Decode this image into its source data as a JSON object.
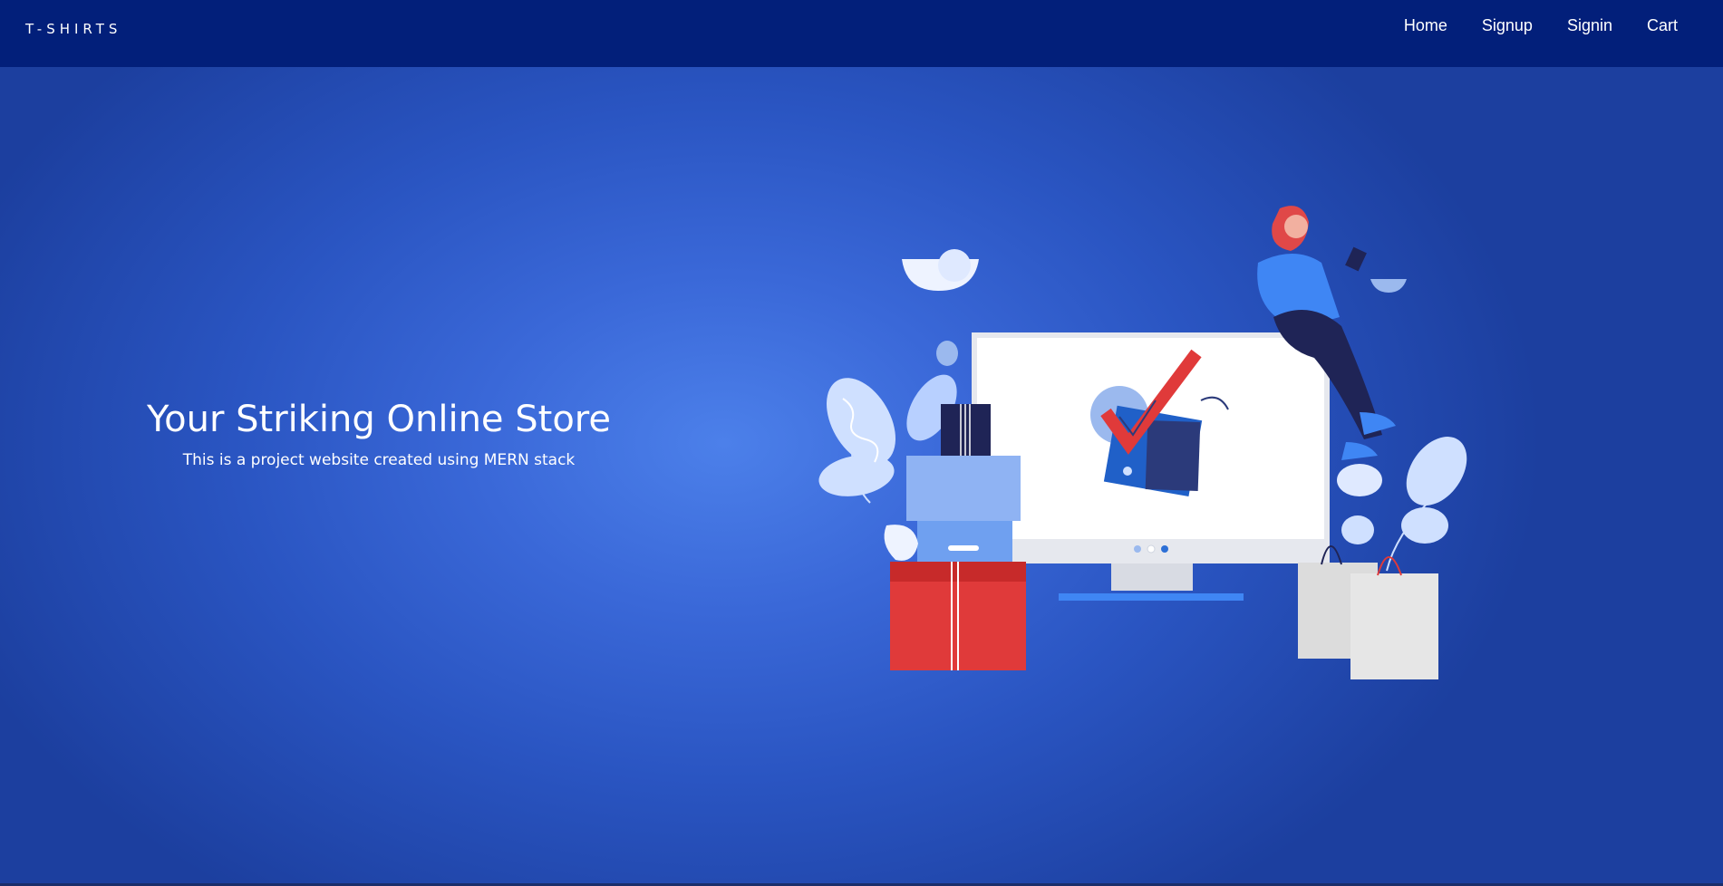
{
  "navbar": {
    "brand": "T-SHIRTS",
    "links": [
      {
        "label": "Home"
      },
      {
        "label": "Signup"
      },
      {
        "label": "Signin"
      },
      {
        "label": "Cart"
      }
    ]
  },
  "hero": {
    "title": "Your Striking Online Store",
    "subtitle": "This is a project website created using MERN stack"
  },
  "colors": {
    "navbar_bg": "#021f7a",
    "hero_bg": "#3a68d8",
    "accent_red": "#e03a3a",
    "text": "#ffffff"
  }
}
